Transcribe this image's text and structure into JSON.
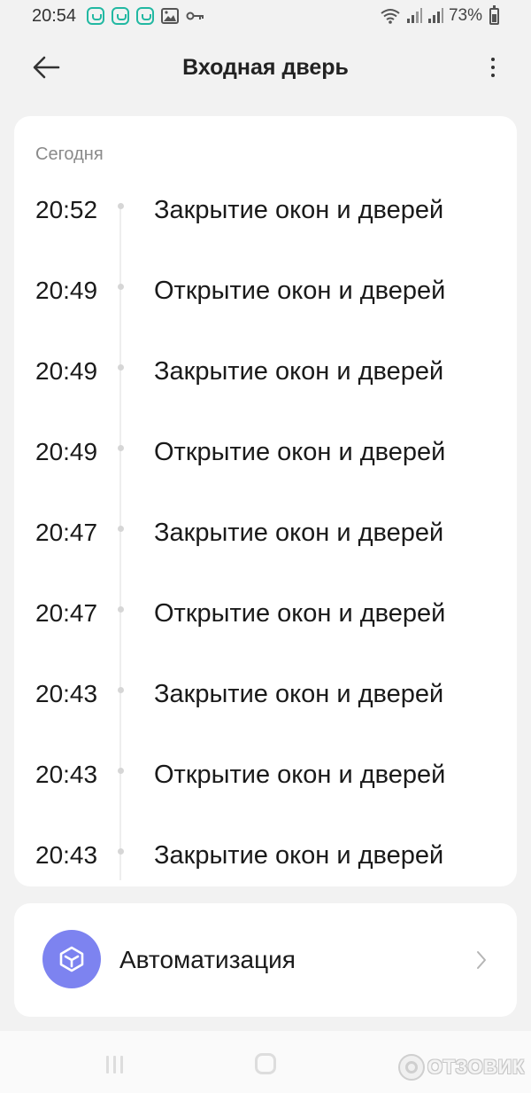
{
  "status_bar": {
    "time": "20:54",
    "battery": "73%",
    "battery_level": 0.73,
    "notification_icons": [
      "mi-home-icon",
      "mi-home-icon",
      "mi-home-icon",
      "gallery-icon",
      "vpn-key-icon"
    ]
  },
  "header": {
    "title": "Входная дверь"
  },
  "log": {
    "section_label": "Сегодня",
    "entries": [
      {
        "time": "20:52",
        "event": "Закрытие окон и дверей"
      },
      {
        "time": "20:49",
        "event": "Открытие окон и дверей"
      },
      {
        "time": "20:49",
        "event": "Закрытие окон и дверей"
      },
      {
        "time": "20:49",
        "event": "Открытие окон и дверей"
      },
      {
        "time": "20:47",
        "event": "Закрытие окон и дверей"
      },
      {
        "time": "20:47",
        "event": "Открытие окон и дверей"
      },
      {
        "time": "20:43",
        "event": "Закрытие окон и дверей"
      },
      {
        "time": "20:43",
        "event": "Открытие окон и дверей"
      },
      {
        "time": "20:43",
        "event": "Закрытие окон и дверей"
      }
    ]
  },
  "automation": {
    "label": "Автоматизация",
    "icon": "automation-cube-icon",
    "icon_color": "#7d83f0"
  },
  "colors": {
    "accent": "#7d83f0",
    "status_icon": "#22b8a2"
  },
  "watermark": {
    "text": "ОТЗОВИК"
  }
}
